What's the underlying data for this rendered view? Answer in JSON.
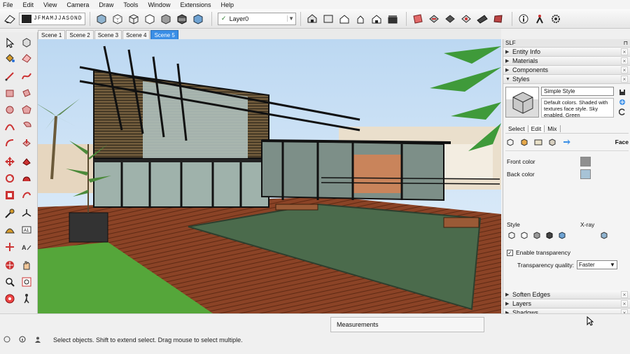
{
  "menu": [
    "File",
    "Edit",
    "View",
    "Camera",
    "Draw",
    "Tools",
    "Window",
    "Extensions",
    "Help"
  ],
  "toolbar": {
    "style_strip": "JFMAMJJASOND",
    "layer": {
      "value": "Layer0",
      "check": "✓",
      "arrow": "▼"
    }
  },
  "scenes": [
    {
      "label": "Scene 1",
      "active": false
    },
    {
      "label": "Scene 2",
      "active": false
    },
    {
      "label": "Scene 3",
      "active": false
    },
    {
      "label": "Scene 4",
      "active": false
    },
    {
      "label": "Scene 5",
      "active": true
    }
  ],
  "tray": {
    "title": "SLF",
    "pin": "⊓",
    "close": "×",
    "tri_collapsed": "▶",
    "tri_expanded": "▼",
    "panels_top": [
      "Entity Info",
      "Materials",
      "Components"
    ],
    "styles": {
      "label": "Styles",
      "style_name": "Simple Style",
      "style_desc": "Default colors. Shaded with textures face style. Sky enabled. Green",
      "tabs": [
        "Select",
        "Edit",
        "Mix"
      ],
      "active_tab": "Edit",
      "section_label": "Face",
      "front_color_label": "Front color",
      "front_color": "#8f8f8f",
      "back_color_label": "Back color",
      "back_color": "#a7c3d6",
      "style_label": "Style",
      "xray_label": "X-ray",
      "transparency_label": "Enable transparency",
      "transparency_checked": "✓",
      "quality_label": "Transparency quality:",
      "quality_value": "Faster",
      "quality_arrow": "▼"
    },
    "panels_bottom": [
      "Soften Edges",
      "Layers",
      "Shadows"
    ]
  },
  "measurements_label": "Measurements",
  "status_text": "Select objects. Shift to extend select. Drag mouse to select multiple.",
  "colors": {
    "accent": "#3a8ee6",
    "sky": "#cfe4f7",
    "deck": "#8b4326",
    "pool": "#4b6b4c",
    "grass": "#55a63a"
  }
}
